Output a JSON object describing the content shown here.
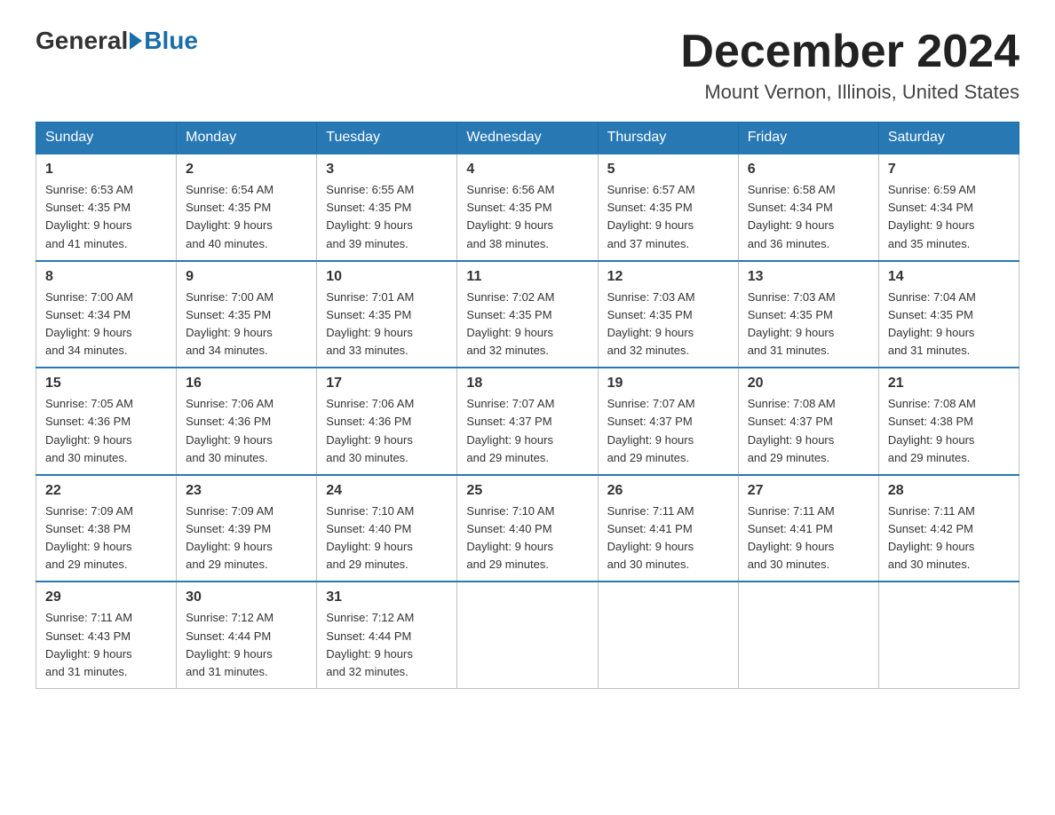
{
  "header": {
    "logo_general": "General",
    "logo_blue": "Blue",
    "month_title": "December 2024",
    "location": "Mount Vernon, Illinois, United States"
  },
  "weekdays": [
    "Sunday",
    "Monday",
    "Tuesday",
    "Wednesday",
    "Thursday",
    "Friday",
    "Saturday"
  ],
  "weeks": [
    [
      {
        "day": "1",
        "sunrise": "6:53 AM",
        "sunset": "4:35 PM",
        "daylight": "9 hours and 41 minutes."
      },
      {
        "day": "2",
        "sunrise": "6:54 AM",
        "sunset": "4:35 PM",
        "daylight": "9 hours and 40 minutes."
      },
      {
        "day": "3",
        "sunrise": "6:55 AM",
        "sunset": "4:35 PM",
        "daylight": "9 hours and 39 minutes."
      },
      {
        "day": "4",
        "sunrise": "6:56 AM",
        "sunset": "4:35 PM",
        "daylight": "9 hours and 38 minutes."
      },
      {
        "day": "5",
        "sunrise": "6:57 AM",
        "sunset": "4:35 PM",
        "daylight": "9 hours and 37 minutes."
      },
      {
        "day": "6",
        "sunrise": "6:58 AM",
        "sunset": "4:34 PM",
        "daylight": "9 hours and 36 minutes."
      },
      {
        "day": "7",
        "sunrise": "6:59 AM",
        "sunset": "4:34 PM",
        "daylight": "9 hours and 35 minutes."
      }
    ],
    [
      {
        "day": "8",
        "sunrise": "7:00 AM",
        "sunset": "4:34 PM",
        "daylight": "9 hours and 34 minutes."
      },
      {
        "day": "9",
        "sunrise": "7:00 AM",
        "sunset": "4:35 PM",
        "daylight": "9 hours and 34 minutes."
      },
      {
        "day": "10",
        "sunrise": "7:01 AM",
        "sunset": "4:35 PM",
        "daylight": "9 hours and 33 minutes."
      },
      {
        "day": "11",
        "sunrise": "7:02 AM",
        "sunset": "4:35 PM",
        "daylight": "9 hours and 32 minutes."
      },
      {
        "day": "12",
        "sunrise": "7:03 AM",
        "sunset": "4:35 PM",
        "daylight": "9 hours and 32 minutes."
      },
      {
        "day": "13",
        "sunrise": "7:03 AM",
        "sunset": "4:35 PM",
        "daylight": "9 hours and 31 minutes."
      },
      {
        "day": "14",
        "sunrise": "7:04 AM",
        "sunset": "4:35 PM",
        "daylight": "9 hours and 31 minutes."
      }
    ],
    [
      {
        "day": "15",
        "sunrise": "7:05 AM",
        "sunset": "4:36 PM",
        "daylight": "9 hours and 30 minutes."
      },
      {
        "day": "16",
        "sunrise": "7:06 AM",
        "sunset": "4:36 PM",
        "daylight": "9 hours and 30 minutes."
      },
      {
        "day": "17",
        "sunrise": "7:06 AM",
        "sunset": "4:36 PM",
        "daylight": "9 hours and 30 minutes."
      },
      {
        "day": "18",
        "sunrise": "7:07 AM",
        "sunset": "4:37 PM",
        "daylight": "9 hours and 29 minutes."
      },
      {
        "day": "19",
        "sunrise": "7:07 AM",
        "sunset": "4:37 PM",
        "daylight": "9 hours and 29 minutes."
      },
      {
        "day": "20",
        "sunrise": "7:08 AM",
        "sunset": "4:37 PM",
        "daylight": "9 hours and 29 minutes."
      },
      {
        "day": "21",
        "sunrise": "7:08 AM",
        "sunset": "4:38 PM",
        "daylight": "9 hours and 29 minutes."
      }
    ],
    [
      {
        "day": "22",
        "sunrise": "7:09 AM",
        "sunset": "4:38 PM",
        "daylight": "9 hours and 29 minutes."
      },
      {
        "day": "23",
        "sunrise": "7:09 AM",
        "sunset": "4:39 PM",
        "daylight": "9 hours and 29 minutes."
      },
      {
        "day": "24",
        "sunrise": "7:10 AM",
        "sunset": "4:40 PM",
        "daylight": "9 hours and 29 minutes."
      },
      {
        "day": "25",
        "sunrise": "7:10 AM",
        "sunset": "4:40 PM",
        "daylight": "9 hours and 29 minutes."
      },
      {
        "day": "26",
        "sunrise": "7:11 AM",
        "sunset": "4:41 PM",
        "daylight": "9 hours and 30 minutes."
      },
      {
        "day": "27",
        "sunrise": "7:11 AM",
        "sunset": "4:41 PM",
        "daylight": "9 hours and 30 minutes."
      },
      {
        "day": "28",
        "sunrise": "7:11 AM",
        "sunset": "4:42 PM",
        "daylight": "9 hours and 30 minutes."
      }
    ],
    [
      {
        "day": "29",
        "sunrise": "7:11 AM",
        "sunset": "4:43 PM",
        "daylight": "9 hours and 31 minutes."
      },
      {
        "day": "30",
        "sunrise": "7:12 AM",
        "sunset": "4:44 PM",
        "daylight": "9 hours and 31 minutes."
      },
      {
        "day": "31",
        "sunrise": "7:12 AM",
        "sunset": "4:44 PM",
        "daylight": "9 hours and 32 minutes."
      },
      null,
      null,
      null,
      null
    ]
  ],
  "labels": {
    "sunrise_prefix": "Sunrise: ",
    "sunset_prefix": "Sunset: ",
    "daylight_prefix": "Daylight: "
  }
}
